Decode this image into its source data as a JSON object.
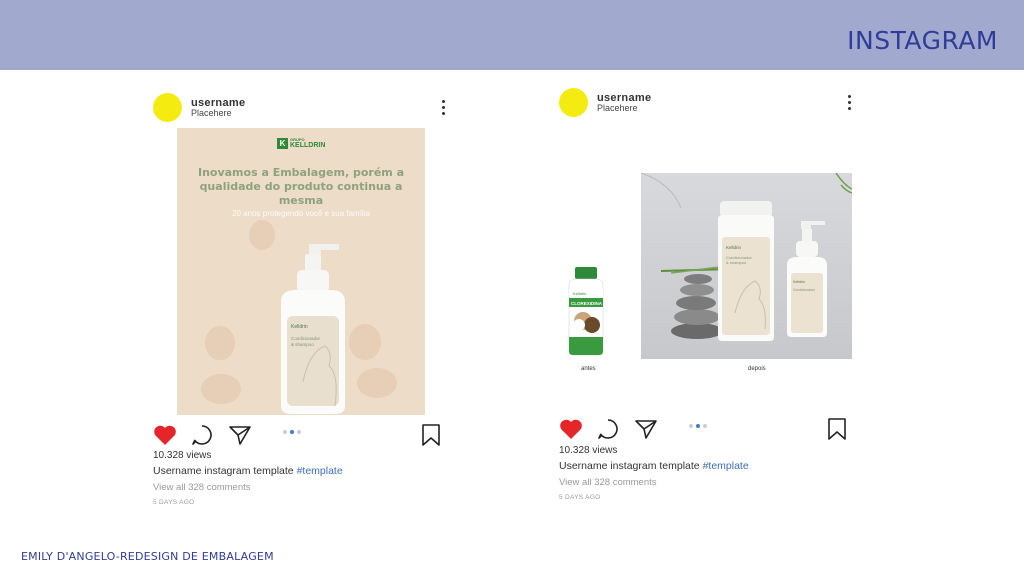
{
  "slide": {
    "title": "INSTAGRAM",
    "footer": "EMILY D'ANGELO-REDESIGN DE EMBALAGEM",
    "header_color": "#a2a9cf",
    "accent": "#2f3d99"
  },
  "posts": [
    {
      "username": "username",
      "location": "Placehere",
      "image": {
        "logo_small": "GRUPO",
        "logo_name": "KELLDRIN",
        "headline": "Inovamos a Embalagem, porém a qualidade do produto continua a mesma",
        "subline": "20 anos protegendo você e sua família",
        "bottle_label": "Condicionador & shampoo"
      },
      "views": "10.328 views",
      "caption_user": "Username instagram template ",
      "caption_tag": "#template",
      "comments": "View all 328 comments",
      "ago": "5 DAYS AGO",
      "carousel_active": 1,
      "icons": [
        "heart-icon",
        "comment-icon",
        "send-icon",
        "bookmark-icon"
      ]
    },
    {
      "username": "username",
      "location": "Placehere",
      "image": {
        "label_before": "antes",
        "label_after": "depois",
        "old_bottle_label": "CLOREXIDINA",
        "bottle_label": "Condicionador & shampoo"
      },
      "views": "10.328 views",
      "caption_user": "Username instagram template ",
      "caption_tag": "#template",
      "comments": "View all 328 comments",
      "ago": "5 DAYS AGO",
      "carousel_active": 1,
      "icons": [
        "heart-icon",
        "comment-icon",
        "send-icon",
        "bookmark-icon"
      ]
    }
  ]
}
